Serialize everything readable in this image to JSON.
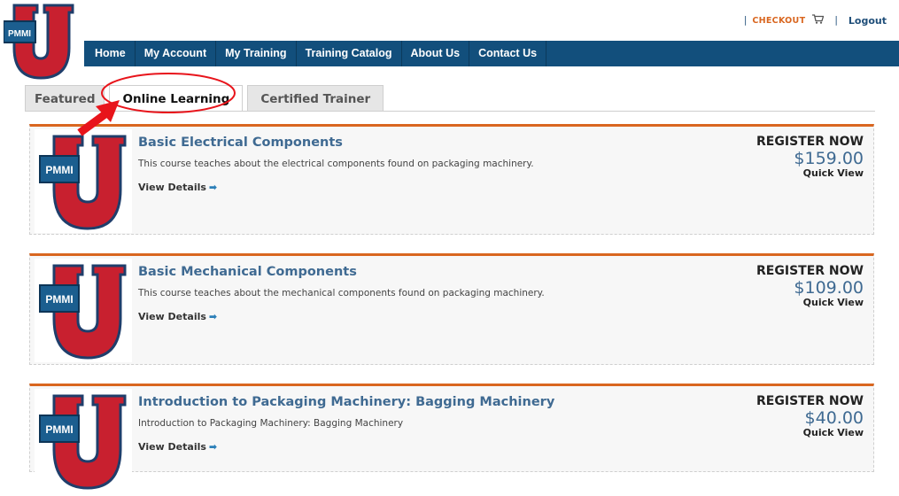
{
  "utility_bar": {
    "checkout_label": "CHECKOUT",
    "cart_icon": "cart-icon",
    "logout_label": "Logout",
    "separator": "|"
  },
  "logo": {
    "badge_text": "PMMI",
    "letter": "U"
  },
  "nav": {
    "items": [
      "Home",
      "My Account",
      "My Training",
      "Training Catalog",
      "About Us",
      "Contact Us"
    ]
  },
  "tabs": {
    "items": [
      "Featured",
      "Online Learning",
      "Certified Trainer"
    ],
    "active": "Online Learning"
  },
  "courses": [
    {
      "title": "Basic Electrical Components",
      "description": "This course teaches about the electrical components found on packaging machinery.",
      "details_label": "View Details",
      "register_label": "REGISTER NOW",
      "price": "$159.00",
      "quick_view_label": "Quick View"
    },
    {
      "title": "Basic Mechanical Components",
      "description": "This course teaches about the mechanical components found on packaging machinery.",
      "details_label": "View Details",
      "register_label": "REGISTER NOW",
      "price": "$109.00",
      "quick_view_label": "Quick View"
    },
    {
      "title": "Introduction to Packaging Machinery: Bagging Machinery",
      "description": "Introduction to Packaging Machinery: Bagging Machinery",
      "details_label": "View Details",
      "register_label": "REGISTER NOW",
      "price": "$40.00",
      "quick_view_label": "Quick View"
    }
  ],
  "colors": {
    "nav_bg": "#124f7c",
    "accent_orange": "#d9661f",
    "title_blue": "#3f6a92",
    "logo_red": "#c8202f",
    "annotation_red": "#e8141b"
  }
}
